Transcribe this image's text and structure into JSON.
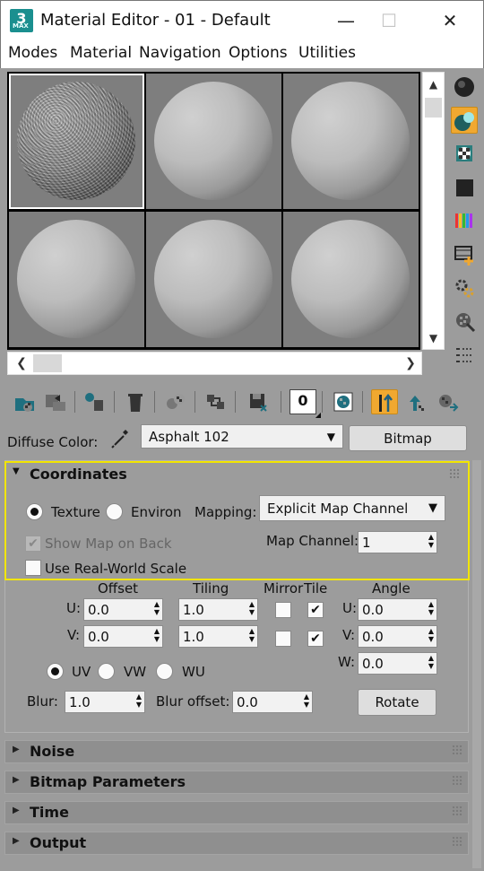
{
  "window": {
    "title": "Material Editor - 01 - Default",
    "icon_label": "3",
    "icon_sub": "MAX",
    "minimize": "—",
    "maximize": "☐",
    "close": "✕"
  },
  "menu": [
    "Modes",
    "Material",
    "Navigation",
    "Options",
    "Utilities"
  ],
  "slots": [
    {
      "material": "asphalt",
      "selected": true
    },
    {
      "material": "default",
      "selected": false
    },
    {
      "material": "default",
      "selected": false
    },
    {
      "material": "default",
      "selected": false
    },
    {
      "material": "default",
      "selected": false
    },
    {
      "material": "default",
      "selected": false
    }
  ],
  "side_icons": [
    "sample-type-icon",
    "backlight-icon",
    "background-checker-icon",
    "background-square-icon",
    "uv-tiling-icon",
    "video-color-check-icon",
    "make-preview-icon",
    "options-gears-icon",
    "select-by-material-icon",
    "material-map-navigator-icon"
  ],
  "toolbar_icons": [
    "get-material-icon",
    "put-to-scene-icon",
    "assign-to-selection-icon",
    "reset-map-icon",
    "make-unique-icon",
    "copy-material-icon",
    "put-to-library-icon",
    "material-id-channel-icon",
    "show-shaded-icon",
    "show-end-result-icon",
    "go-to-parent-icon",
    "go-forward-icon"
  ],
  "toolbar_id_value": "0",
  "diffuse": {
    "label": "Diffuse Color:",
    "map_name": "Asphalt 102",
    "type_button": "Bitmap"
  },
  "coordinates": {
    "title": "Coordinates",
    "texture_label": "Texture",
    "environ_label": "Environ",
    "mapping_label": "Mapping:",
    "mapping_value": "Explicit Map Channel",
    "show_map_on_back": "Show Map on Back",
    "map_channel_label": "Map Channel:",
    "map_channel_value": "1",
    "real_world_scale": "Use Real-World Scale",
    "offset_header": "Offset",
    "tiling_header": "Tiling",
    "mirror_header": "Mirror",
    "tile_header": "Tile",
    "angle_header": "Angle",
    "u_label": "U:",
    "v_label": "V:",
    "w_label": "W:",
    "u_offset": "0.0",
    "v_offset": "0.0",
    "u_tiling": "1.0",
    "v_tiling": "1.0",
    "u_mirror": false,
    "v_mirror": false,
    "u_tile": true,
    "v_tile": true,
    "u_angle": "0.0",
    "v_angle": "0.0",
    "w_angle": "0.0",
    "uv_label": "UV",
    "vw_label": "VW",
    "wu_label": "WU",
    "blur_label": "Blur:",
    "blur_value": "1.0",
    "blur_offset_label": "Blur offset:",
    "blur_offset_value": "0.0",
    "rotate_button": "Rotate"
  },
  "rollouts": [
    "Noise",
    "Bitmap Parameters",
    "Time",
    "Output"
  ],
  "colors": {
    "highlight": "#f0a830",
    "focus_outline": "#f2e500"
  }
}
